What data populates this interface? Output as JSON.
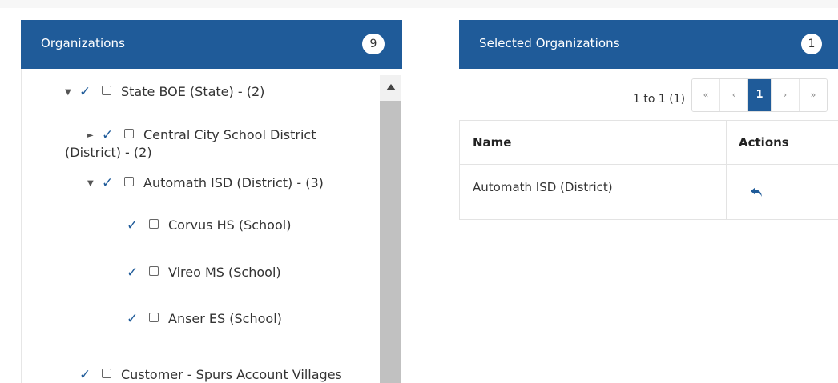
{
  "organizations": {
    "title": "Organizations",
    "count": "9",
    "tree": [
      {
        "label": "State BOE (State) - (2)",
        "toggle": "▼",
        "checked": true
      },
      {
        "label_line1": "Central City School District",
        "label_line2": "(District) - (2)",
        "toggle": "►",
        "checked": true
      },
      {
        "label": "Automath ISD (District) - (3)",
        "toggle": "▼",
        "checked": true
      },
      {
        "label": "Corvus HS (School)",
        "checked": true
      },
      {
        "label": "Vireo MS (School)",
        "checked": true
      },
      {
        "label": "Anser ES (School)",
        "checked": true
      },
      {
        "label": "Customer - Spurs Account Villages",
        "checked": true
      }
    ]
  },
  "selected": {
    "title": "Selected Organizations",
    "count": "1",
    "pager": {
      "summary": "1 to 1 (1)",
      "first": "«",
      "prev": "‹",
      "current": "1",
      "next": "›",
      "last": "»"
    },
    "table": {
      "headers": {
        "name": "Name",
        "actions": "Actions"
      },
      "rows": [
        {
          "name": "Automath ISD (District)",
          "action_icon": "undo-icon"
        }
      ]
    }
  },
  "colors": {
    "header": "#1f5b99",
    "check": "#1f5b99",
    "scrollbar": "#c1c1c1"
  }
}
